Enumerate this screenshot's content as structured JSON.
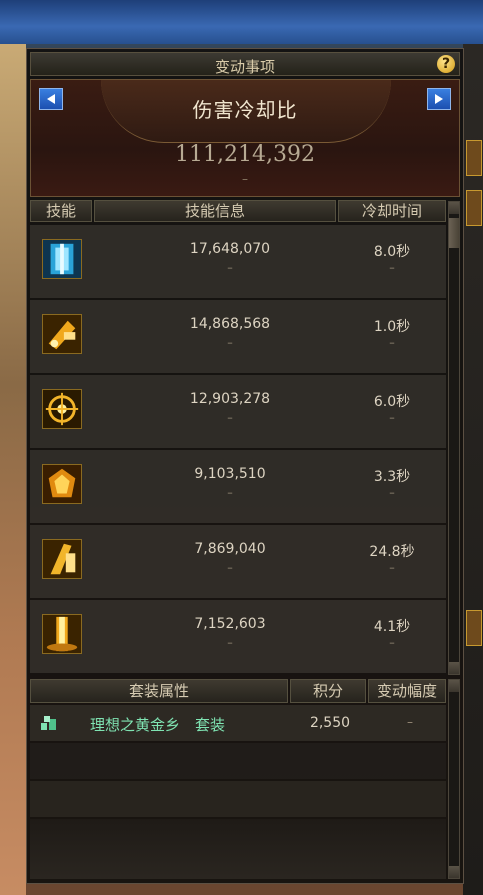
{
  "window": {
    "title": "变动事项",
    "help_label": "?"
  },
  "stat": {
    "name": "伤害冷却比",
    "value": "111,214,392",
    "delta": "–"
  },
  "skills_table": {
    "headers": [
      "技能",
      "技能信息",
      "冷却时间"
    ],
    "rows": [
      {
        "icon": "ice-skill-icon",
        "damage": "17,648,070",
        "damage_delta": "–",
        "cooldown": "8.0秒",
        "cooldown_delta": "–"
      },
      {
        "icon": "hammer-skill-icon",
        "damage": "14,868,568",
        "damage_delta": "–",
        "cooldown": "1.0秒",
        "cooldown_delta": "–"
      },
      {
        "icon": "sun-burst-skill-icon",
        "damage": "12,903,278",
        "damage_delta": "–",
        "cooldown": "6.0秒",
        "cooldown_delta": "–"
      },
      {
        "icon": "flame-shield-skill-icon",
        "damage": "9,103,510",
        "damage_delta": "–",
        "cooldown": "3.3秒",
        "cooldown_delta": "–"
      },
      {
        "icon": "strike-skill-icon",
        "damage": "7,869,040",
        "damage_delta": "–",
        "cooldown": "24.8秒",
        "cooldown_delta": "–"
      },
      {
        "icon": "pillar-skill-icon",
        "damage": "7,152,603",
        "damage_delta": "–",
        "cooldown": "4.1秒",
        "cooldown_delta": "–"
      }
    ]
  },
  "set_table": {
    "headers": [
      "套装属性",
      "积分",
      "变动幅度"
    ],
    "rows": [
      {
        "icon": "set-item-icon",
        "name": "理想之黄金乡　套装",
        "score": "2,550",
        "change": "–"
      }
    ]
  },
  "colors": {
    "accent_gold": "#c7992f",
    "set_name": "#7fe3b2",
    "nav_blue": "#2c66d0"
  }
}
